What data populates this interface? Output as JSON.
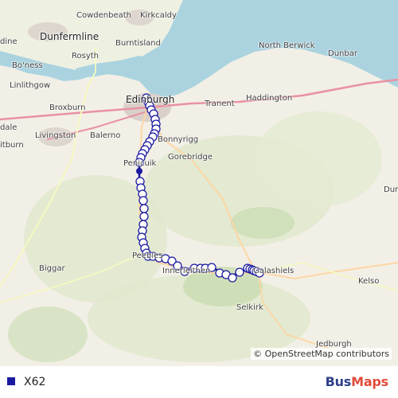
{
  "map": {
    "places": [
      {
        "name": "Cowdenbeath"
      },
      {
        "name": "Kirkcaldy"
      },
      {
        "name": "Dunfermline"
      },
      {
        "name": "Burntisland"
      },
      {
        "name": "dine"
      },
      {
        "name": "Rosyth"
      },
      {
        "name": "Bo'ness"
      },
      {
        "name": "Linlithgow"
      },
      {
        "name": "North Berwick"
      },
      {
        "name": "Dunbar"
      },
      {
        "name": "Edinburgh"
      },
      {
        "name": "Tranent"
      },
      {
        "name": "Haddington"
      },
      {
        "name": "Broxburn"
      },
      {
        "name": "dale"
      },
      {
        "name": "Livingston"
      },
      {
        "name": "Balerno"
      },
      {
        "name": "itburn"
      },
      {
        "name": "Bonnyrigg"
      },
      {
        "name": "Gorebridge"
      },
      {
        "name": "Penicuik"
      },
      {
        "name": "Dur"
      },
      {
        "name": "Biggar"
      },
      {
        "name": "Peebles"
      },
      {
        "name": "Innerleithen"
      },
      {
        "name": "Galashiels"
      },
      {
        "name": "Kelso"
      },
      {
        "name": "Selkirk"
      },
      {
        "name": "Jedburgh"
      }
    ],
    "attribution": "© OpenStreetMap contributors",
    "route_color": "#1a1aa0"
  },
  "legend": {
    "route": "X62",
    "color": "#1a1aa0"
  },
  "brand": {
    "part1": "Bus",
    "part2": "Maps",
    "color1": "#2d3f8a",
    "color2": "#e24a3b"
  }
}
